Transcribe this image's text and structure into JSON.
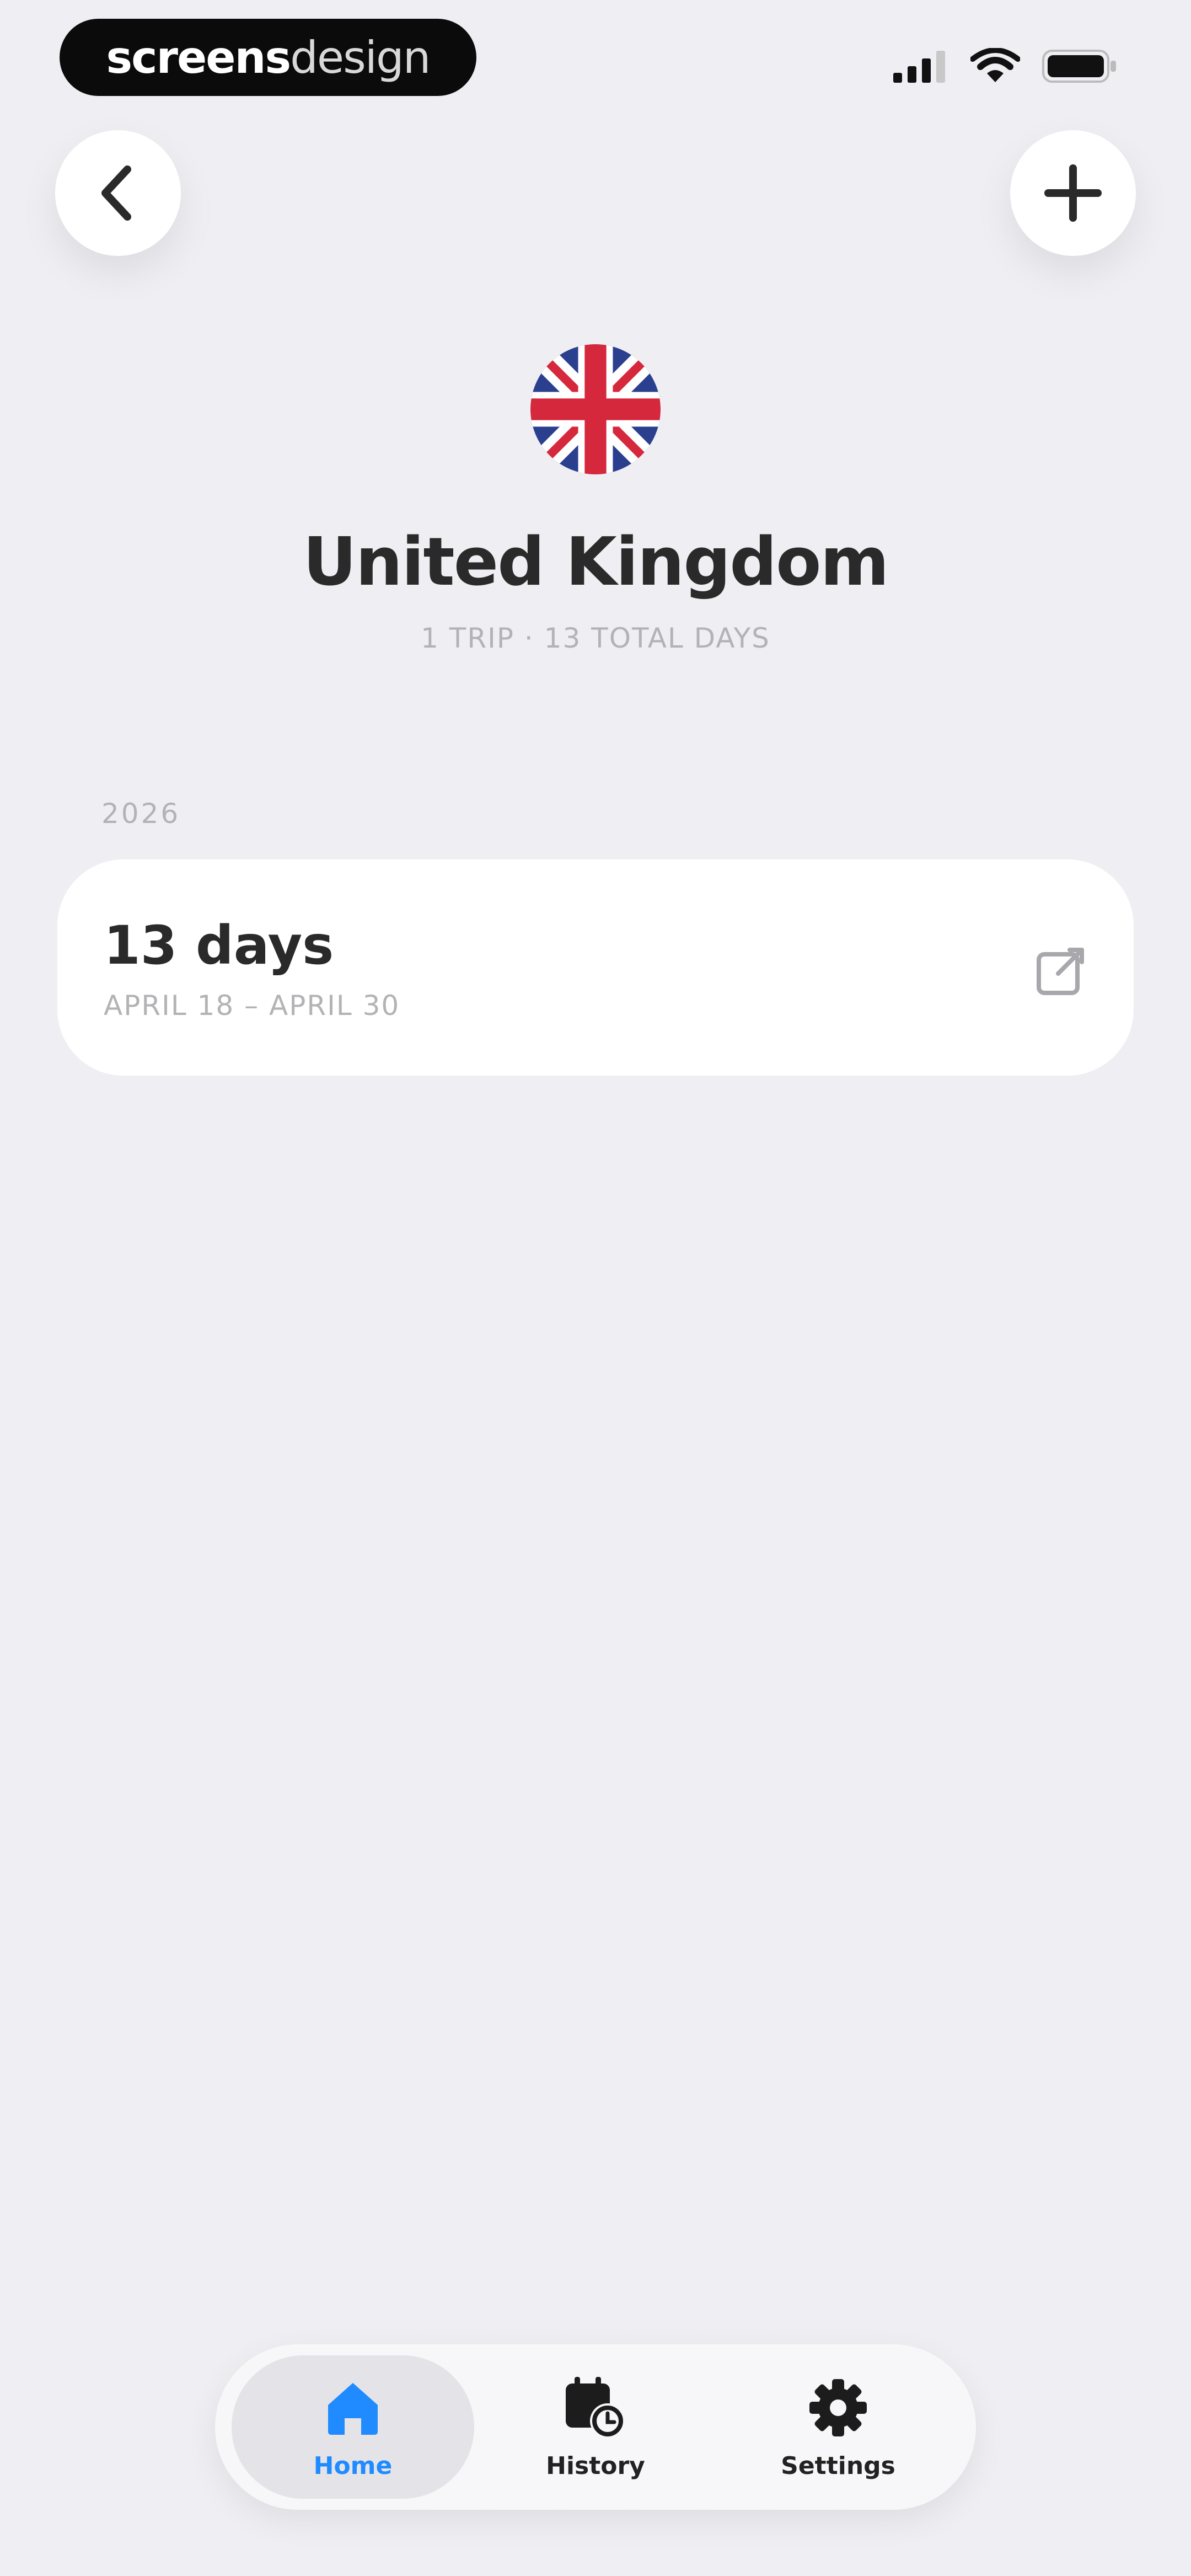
{
  "status_bar": {
    "brand_part1": "screens",
    "brand_part2": "design",
    "icons": [
      "cellular-signal-icon",
      "wifi-icon",
      "battery-icon"
    ]
  },
  "header": {
    "back_icon": "chevron-left-icon",
    "add_icon": "plus-icon"
  },
  "country": {
    "flag_icon": "uk-flag-icon",
    "name": "United Kingdom",
    "summary": "1 TRIP · 13 TOTAL DAYS"
  },
  "trips": {
    "year": "2026",
    "items": [
      {
        "days_label": "13 days",
        "date_range": "APRIL 18 – APRIL 30",
        "edit_icon": "edit-icon"
      }
    ]
  },
  "tab_bar": {
    "tabs": [
      {
        "label": "Home",
        "icon": "home-icon",
        "active": true
      },
      {
        "label": "History",
        "icon": "calendar-clock-icon",
        "active": false
      },
      {
        "label": "Settings",
        "icon": "gear-icon",
        "active": false
      }
    ]
  },
  "colors": {
    "background": "#efeff3",
    "accent": "#1f8bff",
    "card": "#ffffff",
    "text_primary": "#2a2a2a",
    "text_secondary": "#b3b3b6"
  }
}
